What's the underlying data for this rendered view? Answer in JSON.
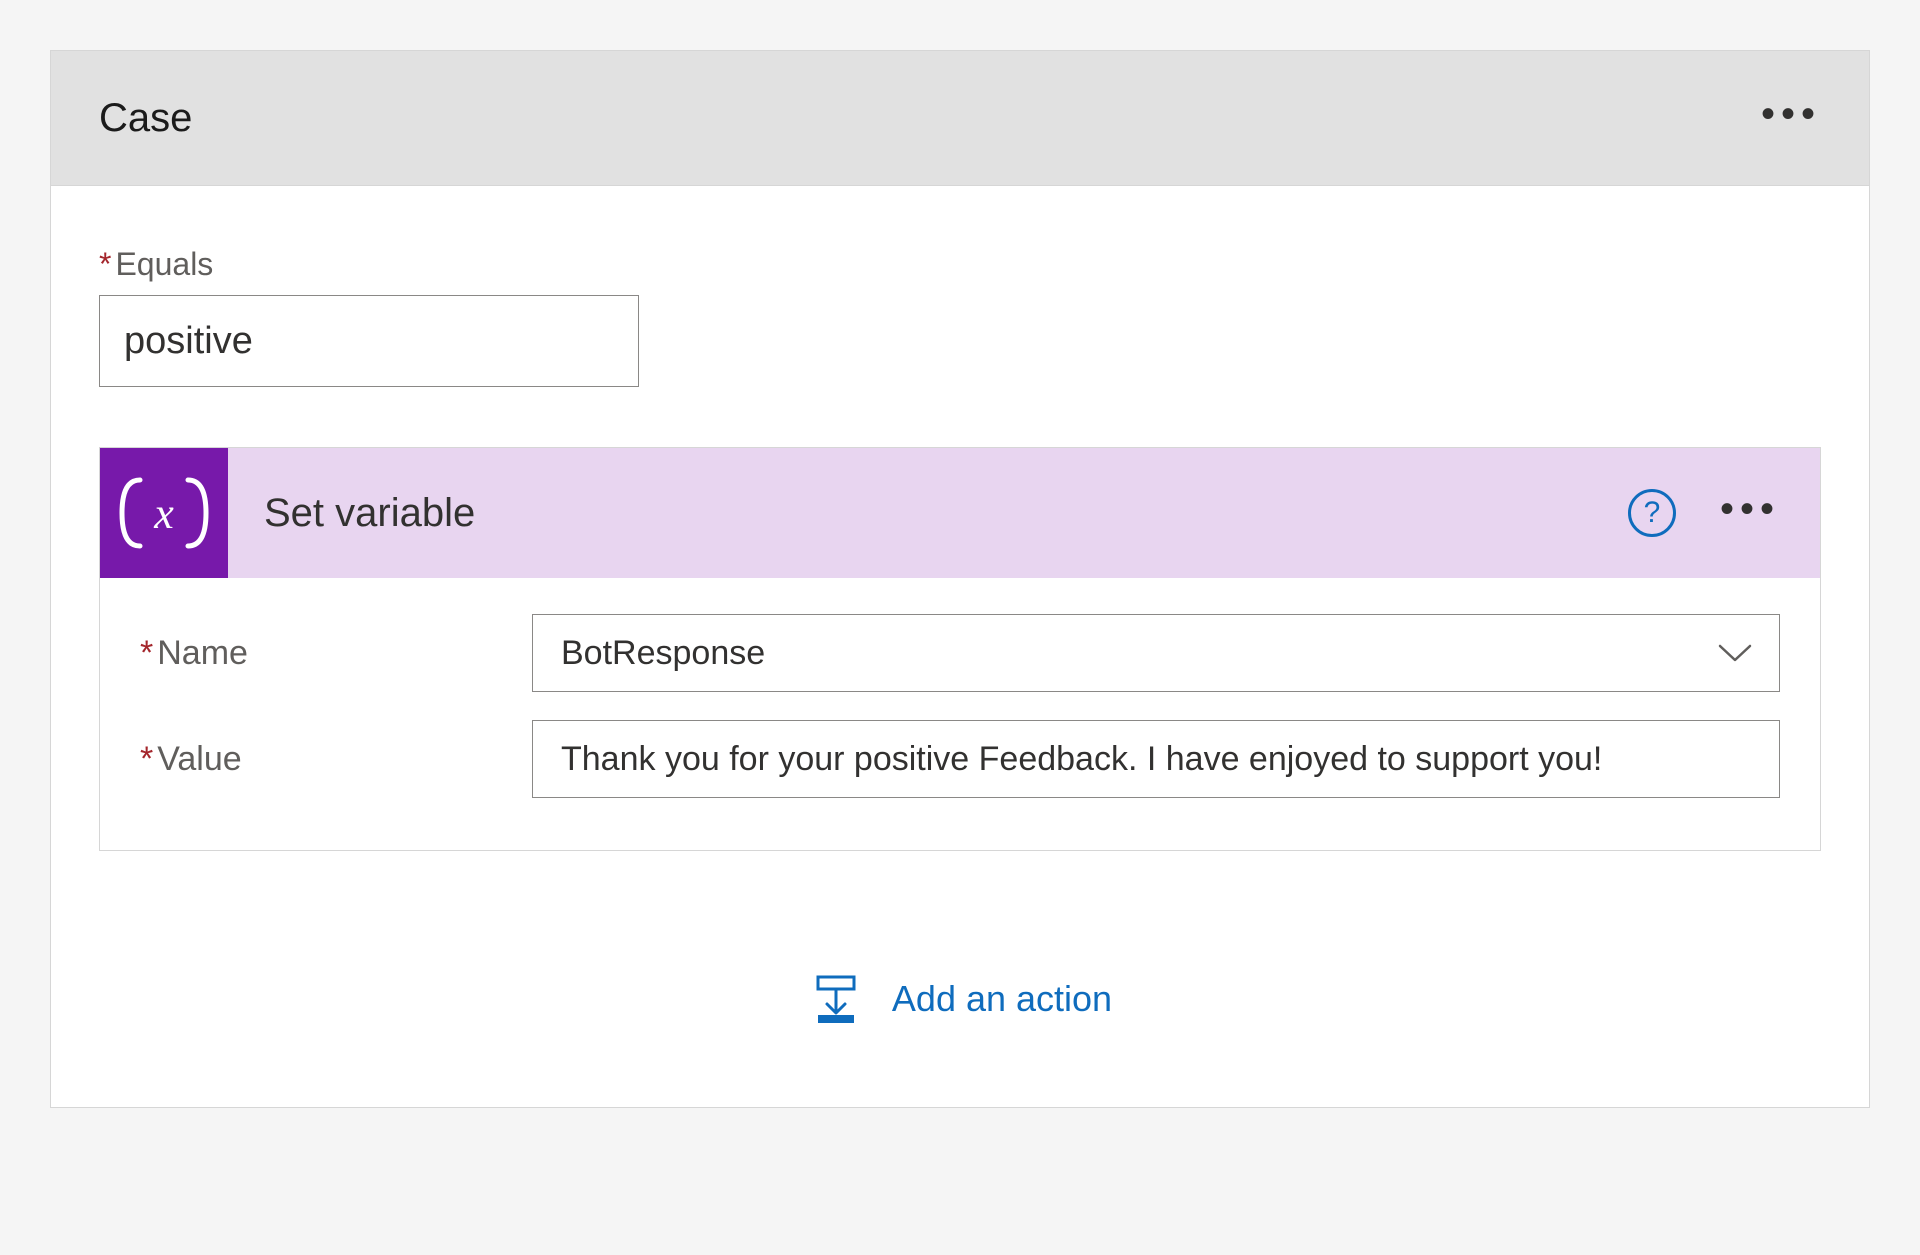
{
  "case": {
    "title": "Case",
    "equals_label": "Equals",
    "equals_value": "positive"
  },
  "action": {
    "title": "Set variable",
    "name_label": "Name",
    "name_value": "BotResponse",
    "value_label": "Value",
    "value_value": "Thank you for your positive Feedback. I have enjoyed to support you!"
  },
  "footer": {
    "add_action": "Add an action"
  }
}
